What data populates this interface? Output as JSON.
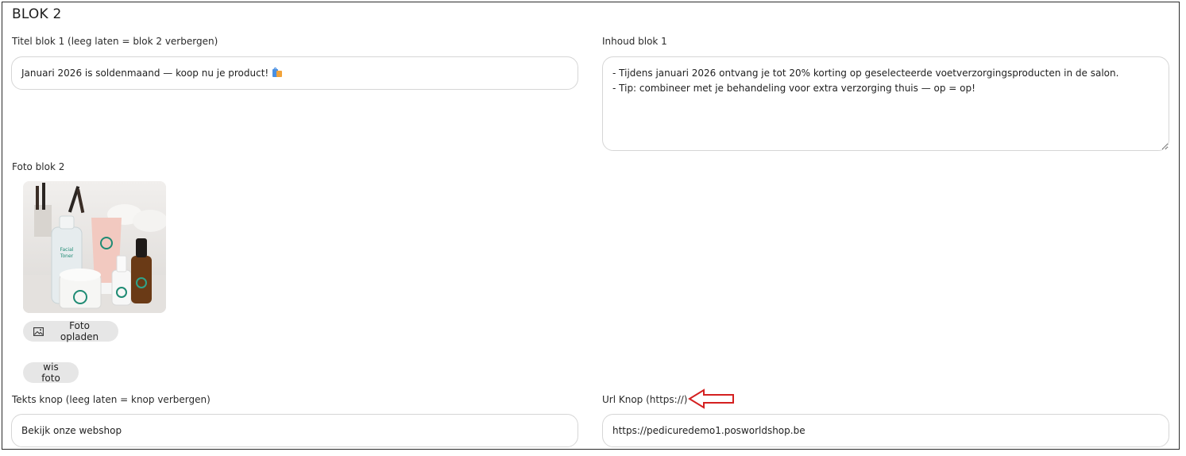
{
  "section": {
    "title": "BLOK 2"
  },
  "titel": {
    "label": "Titel blok 1 (leeg laten = blok 2 verbergen)",
    "value": "Januari 2026 is soldenmaand — koop nu je product!"
  },
  "inhoud": {
    "label": "Inhoud blok 1",
    "value": "- Tijdens januari 2026 ontvang je tot 20% korting op geselecteerde voetverzorgingsproducten in de salon.\n- Tip: combineer met je behandeling voor extra verzorging thuis — op = op!"
  },
  "foto": {
    "label": "Foto blok 2",
    "image_alt": "Facial Toner",
    "upload_label": "Foto opladen",
    "clear_label": "wis foto"
  },
  "knop": {
    "text_label": "Tekts knop (leeg laten = knop verbergen)",
    "text_value": "Bekijk onze webshop",
    "url_label": "Url Knop (https://)",
    "url_value": "https://pedicuredemo1.posworldshop.be"
  },
  "icons": {
    "image": "image-icon",
    "bag": "shopping-bag-icon",
    "annotation": "red-arrow-left-icon"
  },
  "colors": {
    "border": "#d6d6d6",
    "pill": "#e6e6e6",
    "arrow": "#d42020",
    "brand_green": "#1f8b74"
  }
}
